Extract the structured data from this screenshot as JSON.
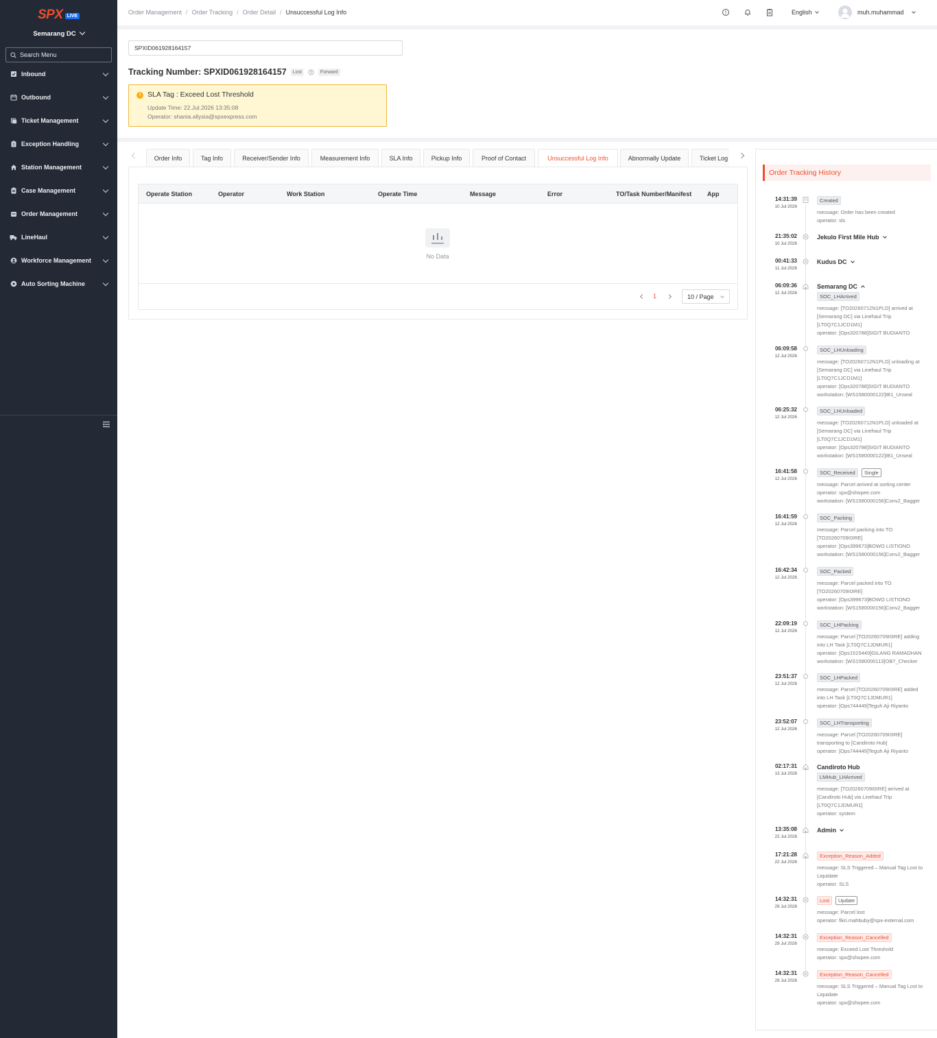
{
  "sidebar": {
    "logo_text": "SPX",
    "logo_badge": "LIVE",
    "dc": "Semarang DC",
    "search_placeholder": "Search Menu",
    "items": [
      {
        "label": "Inbound",
        "icon": "inbound-icon"
      },
      {
        "label": "Outbound",
        "icon": "outbound-icon"
      },
      {
        "label": "Ticket Management",
        "icon": "ticket-icon"
      },
      {
        "label": "Exception Handling",
        "icon": "exception-icon"
      },
      {
        "label": "Station Management",
        "icon": "home-icon"
      },
      {
        "label": "Case Management",
        "icon": "case-icon"
      },
      {
        "label": "Order Management",
        "icon": "order-icon"
      },
      {
        "label": "LineHaul",
        "icon": "truck-icon"
      },
      {
        "label": "Workforce Management",
        "icon": "user-icon"
      },
      {
        "label": "Auto Sorting Machine",
        "icon": "gear-icon"
      }
    ]
  },
  "header": {
    "breadcrumb": [
      "Order Management",
      "Order Tracking",
      "Order Detail",
      "Unsuccessful Log Info"
    ],
    "language": "English",
    "username": "muh.muhammad"
  },
  "search": {
    "value": "SPXID061928164157"
  },
  "tracking": {
    "label": "Tracking Number: SPXID061928164157",
    "tag_lost": "Lost",
    "tag_forward": "Forward"
  },
  "sla": {
    "title": "SLA Tag : Exceed Lost Threshold",
    "update_time": "Update Time: 22.Jul.2026 13:35:08",
    "operator": "Operator: shania.allysia@spxexpress.com"
  },
  "tabs": [
    "Order Info",
    "Tag Info",
    "Receiver/Sender Info",
    "Measurement Info",
    "SLA Info",
    "Pickup Info",
    "Proof of Contact",
    "Unsuccessful Log Info",
    "Abnormally Update",
    "Ticket Log"
  ],
  "active_tab": "Unsuccessful Log Info",
  "table": {
    "columns": [
      "Operate Station",
      "Operator",
      "Work Station",
      "Operate Time",
      "Message",
      "Error",
      "TO/Task Number/Manifest",
      "App"
    ],
    "empty_text": "No Data",
    "page": "1",
    "page_size": "10 / Page"
  },
  "history": {
    "title": "Order Tracking History",
    "events": [
      {
        "time": "14:31:39",
        "date": "10 Jul 2026",
        "tag": "Created",
        "lines": [
          "message: Order has been created",
          "operator: sls"
        ]
      },
      {
        "time": "21:35:02",
        "date": "10 Jul 2026",
        "station": "Jekulo First Mile Hub"
      },
      {
        "time": "00:41:33",
        "date": "11 Jul 2026",
        "station": "Kudus DC"
      },
      {
        "time": "06:09:36",
        "date": "12 Jul 2026",
        "station": "Semarang DC",
        "tag": "SOC_LHArrived",
        "lines": [
          "message: [TO20260712N1PLD] arrived at",
          "[Semarang DC] via Linehaul Trip",
          "[LT0Q7C1JCD1M1]",
          "operator: [Ops320788]SIGIT BUDIANTO"
        ]
      },
      {
        "time": "06:09:58",
        "date": "12 Jul 2026",
        "tag": "SOC_LHUnloading",
        "lines": [
          "message: [TO20260712N1PLD] unloading at",
          "[Semarang DC] via Linehaul Trip",
          "[LT0Q7C1JCD1M1]",
          "operator: [Ops320788]SIGIT BUDIANTO",
          "workstation: [WS1580000122]IB1_Unseal"
        ]
      },
      {
        "time": "06:25:32",
        "date": "12 Jul 2026",
        "tag": "SOC_LHUnloaded",
        "lines": [
          "message: [TO20260712N1PLD] unloaded at",
          "[Semarang DC] via Linehaul Trip",
          "[LT0Q7C1JCD1M1]",
          "operator: [Ops320788]SIGIT BUDIANTO",
          "workstation: [WS1580000122]IB1_Unseal"
        ]
      },
      {
        "time": "16:41:58",
        "date": "12 Jul 2026",
        "tag": "SOC_Received",
        "tag2": "Single",
        "lines": [
          "message: Parcel arrived at sorting center",
          "operator: spx@shopee.com",
          "workstation: [WS1580000156]Conv2_Bagger"
        ]
      },
      {
        "time": "16:41:59",
        "date": "12 Jul 2026",
        "tag": "SOC_Packing",
        "lines": [
          "message: Parcel packing into TO",
          "[TO20260709I0IRE]",
          "operator: [Ops399673]BOWO LISTIONO",
          "workstation: [WS1580000156]Conv2_Bagger"
        ]
      },
      {
        "time": "16:42:34",
        "date": "12 Jul 2026",
        "tag": "SOC_Packed",
        "lines": [
          "message: Parcel packed into TO",
          "[TO20260709I0IRE]",
          "operator: [Ops399673]BOWO LISTIONO",
          "workstation: [WS1580000156]Conv2_Bagger"
        ]
      },
      {
        "time": "22:09:19",
        "date": "12 Jul 2026",
        "tag": "SOC_LHPacking",
        "lines": [
          "message: Parcel [TO20260709I0IRE] adding",
          "into LH Task [LT0Q7C1JDMUR1]",
          "operator: [Ops1515449]GILANG RAMADHAN",
          "workstation: [WS1580000113]OB7_Checker"
        ]
      },
      {
        "time": "23:51:37",
        "date": "12 Jul 2026",
        "tag": "SOC_LHPacked",
        "lines": [
          "message: Parcel [TO20260709I0IRE] added",
          "into LH Task [LT0Q7C1JDMUR1]",
          "operator: [Ops744449]Teguh Aji Riyanto"
        ]
      },
      {
        "time": "23:52:07",
        "date": "12 Jul 2026",
        "tag": "SOC_LHTransporting",
        "lines": [
          "message: Parcel [TO20260709I0IRE]",
          "transporting to [Candiroto Hub]",
          "operator: [Ops744449]Teguh Aji Riyanto"
        ]
      },
      {
        "time": "02:17:31",
        "date": "13 Jul 2026",
        "station": "Candiroto Hub",
        "tag": "LMHub_LHArrived",
        "lines": [
          "message: [TO20260709I0IRE] arrived at",
          "[Candiroto Hub] via Linehaul Trip",
          "[LT0Q7C1JDMUR1]",
          "operator: system"
        ]
      },
      {
        "time": "13:35:08",
        "date": "22 Jul 2026",
        "station": "Admin"
      },
      {
        "time": "17:21:28",
        "date": "22 Jul 2026",
        "tag": "Exception_Reason_Added",
        "lines": [
          "message: SLS Triggered – Manual Tag Lost to",
          "Liquidate",
          "operator: SLS"
        ]
      },
      {
        "time": "14:32:31",
        "date": "29 Jul 2026",
        "tag": "Lost",
        "tag2": "Update",
        "lines": [
          "message: Parcel lost",
          "operator: fikri.mahbuby@spx-external.com"
        ]
      },
      {
        "time": "14:32:31",
        "date": "29 Jul 2026",
        "tag": "Exception_Reason_Cancelled",
        "lines": [
          "message: Exceed Lost Threshold",
          "operator: spx@shopee.com"
        ]
      },
      {
        "time": "14:32:31",
        "date": "29 Jul 2026",
        "tag": "Exception_Reason_Cancelled",
        "lines": [
          "message: SLS Triggered – Manual Tag Lost to",
          "Liquidate",
          "operator: spx@shopee.com"
        ]
      }
    ]
  },
  "colors": {
    "sidebar_bg": "#232a36",
    "brand": "#ee4d2d",
    "live_badge": "#1a6cf3",
    "warning": "#faad14"
  }
}
